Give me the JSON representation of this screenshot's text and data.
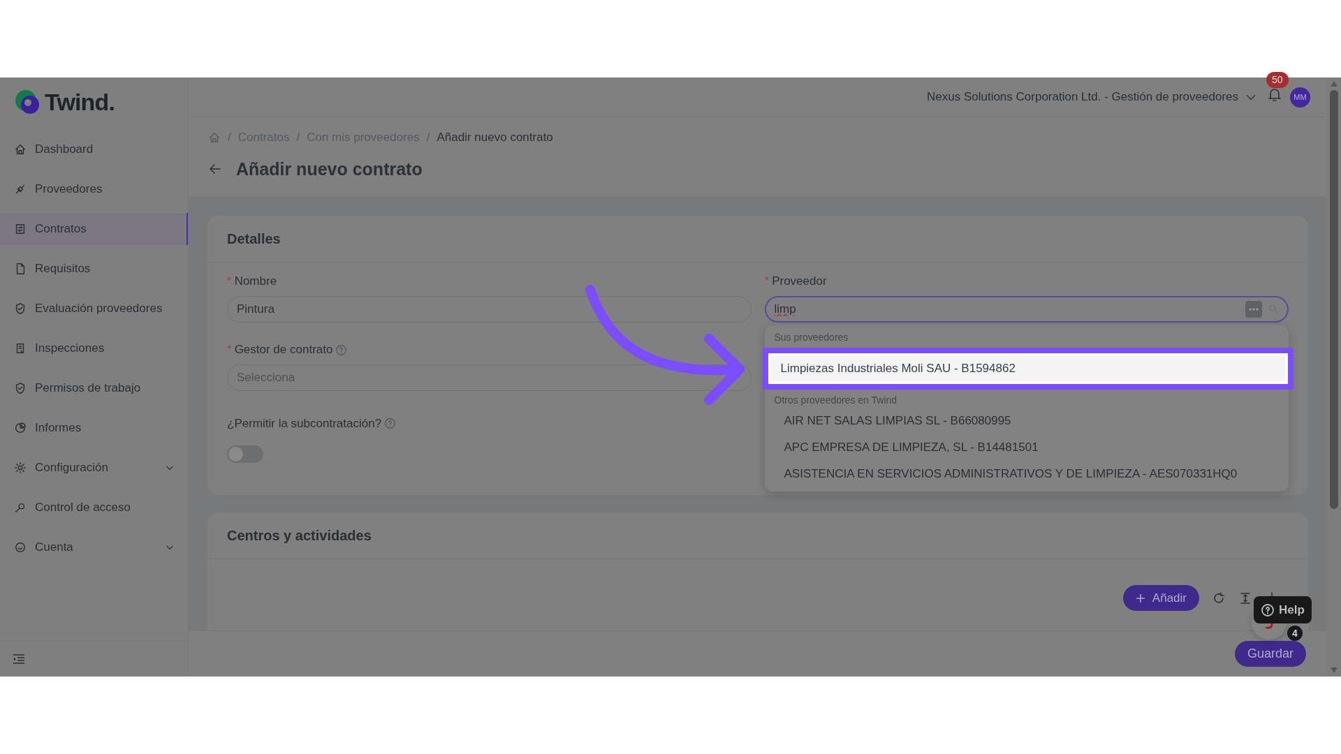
{
  "logo": {
    "text": "Twind."
  },
  "sidebar": {
    "items": [
      {
        "label": "Dashboard",
        "selected": false,
        "expandable": false
      },
      {
        "label": "Proveedores",
        "selected": false,
        "expandable": false
      },
      {
        "label": "Contratos",
        "selected": true,
        "expandable": false
      },
      {
        "label": "Requisitos",
        "selected": false,
        "expandable": false
      },
      {
        "label": "Evaluación proveedores",
        "selected": false,
        "expandable": false
      },
      {
        "label": "Inspecciones",
        "selected": false,
        "expandable": false
      },
      {
        "label": "Permisos de trabajo",
        "selected": false,
        "expandable": false
      },
      {
        "label": "Informes",
        "selected": false,
        "expandable": false
      },
      {
        "label": "Configuración",
        "selected": false,
        "expandable": true
      },
      {
        "label": "Control de acceso",
        "selected": false,
        "expandable": false
      },
      {
        "label": "Cuenta",
        "selected": false,
        "expandable": true
      }
    ]
  },
  "header": {
    "company": "Nexus Solutions Corporation Ltd. - Gestión de proveedores",
    "notifications": "50",
    "avatar": "MM"
  },
  "breadcrumb": [
    {
      "separator": "/",
      "label": "Contratos"
    },
    {
      "separator": "/",
      "label": "Con mis proveedores"
    },
    {
      "separator": "/",
      "label": "Añadir nuevo contrato"
    }
  ],
  "page_title": "Añadir nuevo contrato",
  "details": {
    "title": "Detalles",
    "nombre": {
      "required_mark": "*",
      "label": "Nombre",
      "value": "Pintura"
    },
    "gestor": {
      "required_mark": "*",
      "label": "Gestor de contrato",
      "placeholder": "Selecciona"
    },
    "subcontract": {
      "label": "¿Permitir la subcontratación?",
      "on": false
    },
    "proveedor": {
      "required_mark": "*",
      "label": "Proveedor",
      "value": "limp"
    }
  },
  "dropdown": {
    "groups": [
      {
        "heading": "Sus proveedores",
        "options": [
          {
            "label": "Limpiezas Industriales Moli SAU - B1594862",
            "selected": true
          }
        ]
      },
      {
        "heading": "Otros proveedores en Twind",
        "options": [
          {
            "label": "AIR NET SALAS LIMPIAS SL - B66080995",
            "selected": false
          },
          {
            "label": "APC EMPRESA DE LIMPIEZA, SL - B14481501",
            "selected": false
          },
          {
            "label": "ASISTENCIA EN SERVICIOS ADMINISTRATIVOS Y DE LIMPIEZA - AES070331HQ0",
            "selected": false
          }
        ]
      }
    ]
  },
  "centros": {
    "title": "Centros y actividades",
    "add_button": "Añadir"
  },
  "help": {
    "label": "Help",
    "chat_badge": "4"
  },
  "save_button": "Guardar"
}
